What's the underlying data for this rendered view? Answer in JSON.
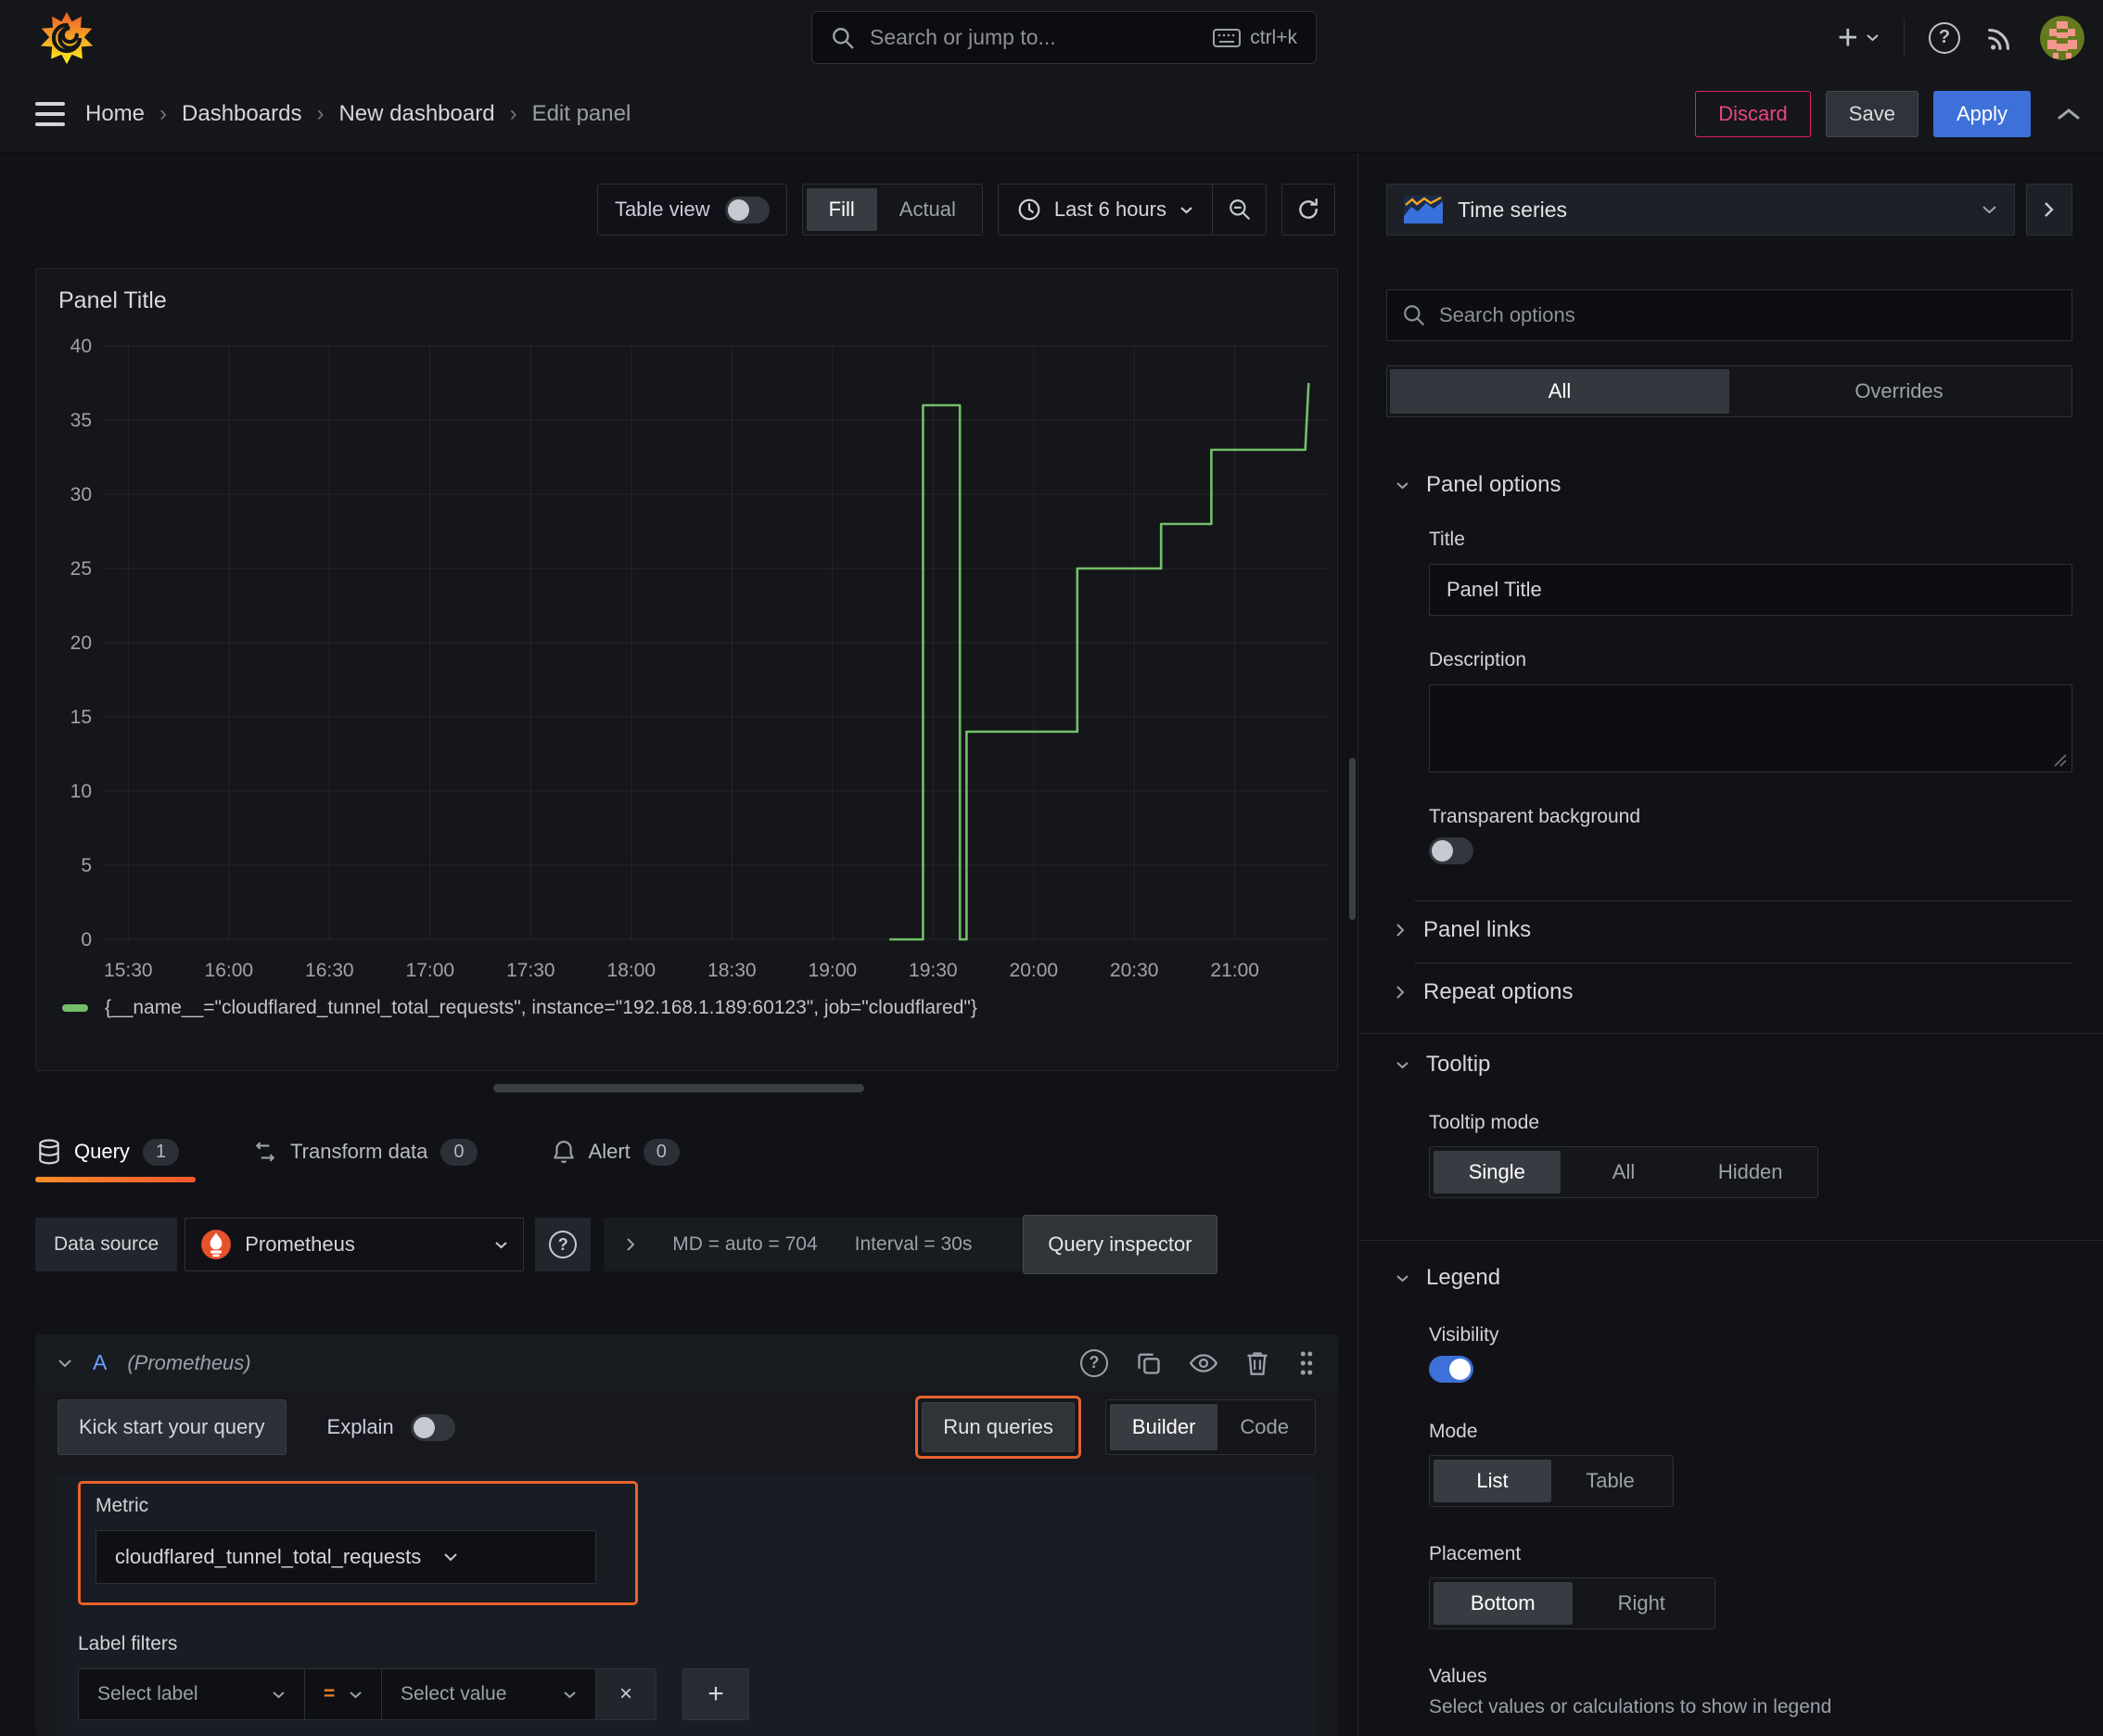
{
  "colors": {
    "accent_orange": "#e8622c",
    "primary_blue": "#3d71d9",
    "series_green": "#73bf69",
    "discard_pink": "#e0226a"
  },
  "topnav": {
    "search_placeholder": "Search or jump to...",
    "shortcut": "ctrl+k"
  },
  "breadcrumb": {
    "items": [
      "Home",
      "Dashboards",
      "New dashboard",
      "Edit panel"
    ]
  },
  "actions": {
    "discard": "Discard",
    "save": "Save",
    "apply": "Apply"
  },
  "toolbar": {
    "table_view": "Table view",
    "fill": "Fill",
    "actual": "Actual",
    "time_range": "Last 6 hours"
  },
  "panel": {
    "title": "Panel Title"
  },
  "chart_data": {
    "type": "line",
    "title": "Panel Title",
    "xlabel": "",
    "ylabel": "",
    "x_range": [
      "15:23",
      "21:28"
    ],
    "x_ticks": [
      "15:30",
      "16:00",
      "16:30",
      "17:00",
      "17:30",
      "18:00",
      "18:30",
      "19:00",
      "19:30",
      "20:00",
      "20:30",
      "21:00"
    ],
    "y_ticks": [
      0,
      5,
      10,
      15,
      20,
      25,
      30,
      35,
      40
    ],
    "ylim": [
      0,
      40
    ],
    "grid": true,
    "legend_position": "bottom",
    "series": [
      {
        "name": "{__name__=\"cloudflared_tunnel_total_requests\", instance=\"192.168.1.189:60123\", job=\"cloudflared\"}",
        "color": "#73bf69",
        "points": [
          [
            "19:17",
            0
          ],
          [
            "19:27",
            0
          ],
          [
            "19:27",
            36
          ],
          [
            "19:38",
            36
          ],
          [
            "19:38",
            0
          ],
          [
            "19:40",
            0
          ],
          [
            "19:40",
            14
          ],
          [
            "20:13",
            14
          ],
          [
            "20:13",
            25
          ],
          [
            "20:38",
            25
          ],
          [
            "20:38",
            28
          ],
          [
            "20:53",
            28
          ],
          [
            "20:53",
            33
          ],
          [
            "21:21",
            33
          ],
          [
            "21:22",
            37.5
          ]
        ]
      }
    ]
  },
  "query": {
    "tabs": [
      {
        "label": "Query",
        "badge": "1"
      },
      {
        "label": "Transform data",
        "badge": "0"
      },
      {
        "label": "Alert",
        "badge": "0"
      }
    ],
    "datasource_label": "Data source",
    "datasource": "Prometheus",
    "max_data_points": "MD = auto = 704",
    "interval": "Interval = 30s",
    "inspector": "Query inspector",
    "row_ref": "A",
    "row_hint": "(Prometheus)",
    "kick_start": "Kick start your query",
    "explain": "Explain",
    "run": "Run queries",
    "builder": "Builder",
    "code": "Code",
    "metric_label": "Metric",
    "metric_value": "cloudflared_tunnel_total_requests",
    "filters_label": "Label filters",
    "select_label": "Select label",
    "operator": "=",
    "select_value": "Select value"
  },
  "sidebar": {
    "viz": "Time series",
    "search_placeholder": "Search options",
    "tabs": [
      "All",
      "Overrides"
    ],
    "panel_options": {
      "title": "Panel options",
      "title_label": "Title",
      "title_value": "Panel Title",
      "description_label": "Description",
      "transparent_label": "Transparent background"
    },
    "collapsed": [
      "Panel links",
      "Repeat options"
    ],
    "tooltip": {
      "title": "Tooltip",
      "mode_label": "Tooltip mode",
      "options": [
        "Single",
        "All",
        "Hidden"
      ],
      "active": "Single"
    },
    "legend": {
      "title": "Legend",
      "visibility_label": "Visibility",
      "mode_label": "Mode",
      "mode_options": [
        "List",
        "Table"
      ],
      "mode_active": "List",
      "placement_label": "Placement",
      "placement_options": [
        "Bottom",
        "Right"
      ],
      "placement_active": "Bottom",
      "values_label": "Values",
      "values_hint": "Select values or calculations to show in legend"
    }
  }
}
